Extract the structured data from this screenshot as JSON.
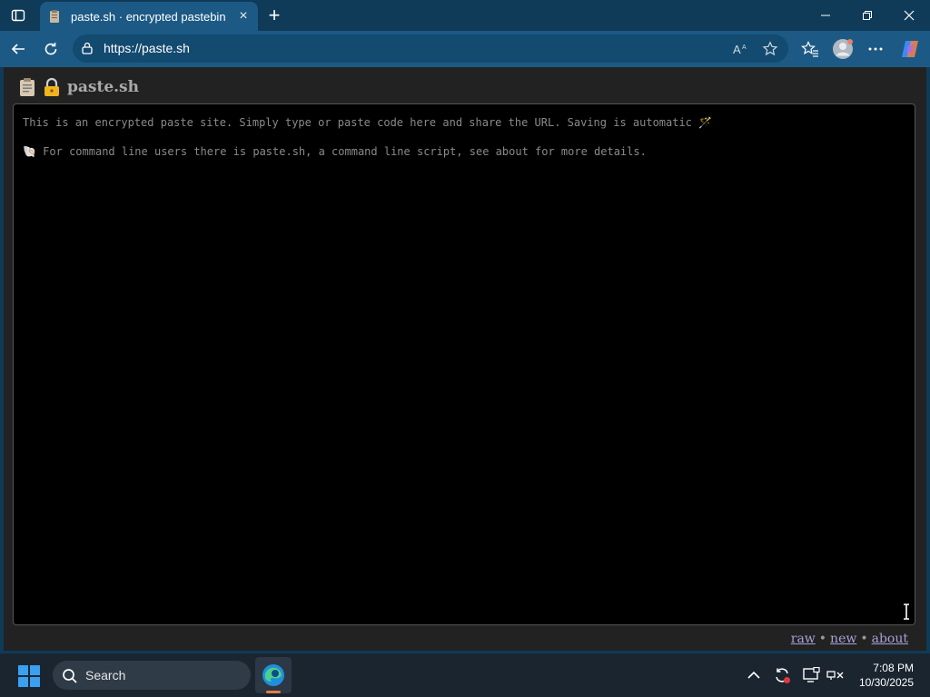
{
  "browser": {
    "tab_title": "paste.sh · encrypted pastebin",
    "url": "https://paste.sh",
    "new_tab_symbol": "+",
    "close_symbol": "×"
  },
  "page": {
    "site_title": "paste.sh",
    "editor_line1": "This is an encrypted paste site. Simply type or paste code here and share the URL. Saving is automatic 🪄",
    "editor_line2": "🐚 For command line users there is paste.sh, a command line script, see about for more details.",
    "header_icons": [
      "clipboard-icon",
      "lock-icon"
    ],
    "footer": {
      "raw": "raw",
      "new": "new",
      "about": "about",
      "separator": "•"
    }
  },
  "taskbar": {
    "search_label": "Search",
    "time": "7:08 PM",
    "date": "10/30/2025"
  },
  "colors": {
    "tabbar": "#0f3a58",
    "toolbar": "#1c5a85",
    "page_bg": "#222222",
    "editor_bg": "#000000",
    "link": "#a3a3d6"
  }
}
